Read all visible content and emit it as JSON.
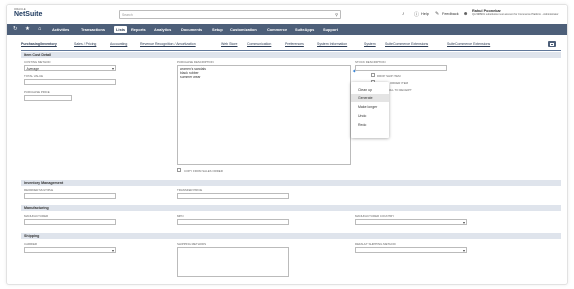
{
  "header": {
    "logo_small": "ORACLE",
    "logo_big": "NetSuite",
    "search_placeholder": "Search",
    "help_label": "Help",
    "feedback_label": "Feedback",
    "user_name": "Rahul Poonekar",
    "user_role": "QA 998901 substitution test account for Commerce Platform - Administrator"
  },
  "nav": {
    "items": [
      "Activities",
      "Transactions",
      "Lists",
      "Reports",
      "Analytics",
      "Documents",
      "Setup",
      "Customization",
      "Commerce",
      "SuiteApps",
      "Support"
    ],
    "active": "Lists"
  },
  "subtabs": [
    "Purchasing/Inventory",
    "Sales / Pricing",
    "Accounting",
    "Revenue Recognition / Amortization",
    "Web Store",
    "Communication",
    "Preferences",
    "System Information",
    "System",
    "SuiteCommerce Extensions",
    "SuiteCommerce Extensions"
  ],
  "sections": {
    "item_cost": {
      "title": "Item Cost Detail",
      "costing_method_label": "COSTING METHOD",
      "costing_method_value": "Average",
      "total_value_label": "TOTAL VALUE",
      "purchase_price_label": "PURCHASE PRICE",
      "purchase_description_label": "PURCHASE DESCRIPTION",
      "purchase_description_lines": [
        "women's sandals",
        "black rubber",
        "summer wear"
      ],
      "copy_from_sales_label": "COPY FROM SALES ORDER",
      "stock_description_label": "STOCK DESCRIPTION",
      "drop_ship_label": "DROP SHIP ITEM",
      "special_order_label": "SPECIAL ORDER ITEM",
      "match_bill_label": "MATCH BILL TO RECEIPT"
    },
    "inventory": {
      "title": "Inventory Management",
      "reorder_multiple_label": "REORDER MULTIPLE",
      "transfer_price_label": "TRANSFER PRICE"
    },
    "manufacturing": {
      "title": "Manufacturing",
      "manufacturer_label": "MANUFACTURER",
      "mpn_label": "MPN",
      "manufacturer_country_label": "MANUFACTURER COUNTRY"
    },
    "shipping": {
      "title": "Shipping",
      "carrier_label": "CARRIER",
      "shipping_methods_label": "SHIPPING METHODS",
      "default_shipping_method_label": "DEFAULT SHIPPING METHOD"
    }
  },
  "context_menu": {
    "items": [
      "Clean up",
      "Generate",
      "Make longer",
      "Undo",
      "Redo"
    ],
    "highlighted": "Generate"
  },
  "colors": {
    "nav_bg": "#4d5f79",
    "section_bg": "#dfe4ec",
    "accent": "#2b7cd3"
  }
}
